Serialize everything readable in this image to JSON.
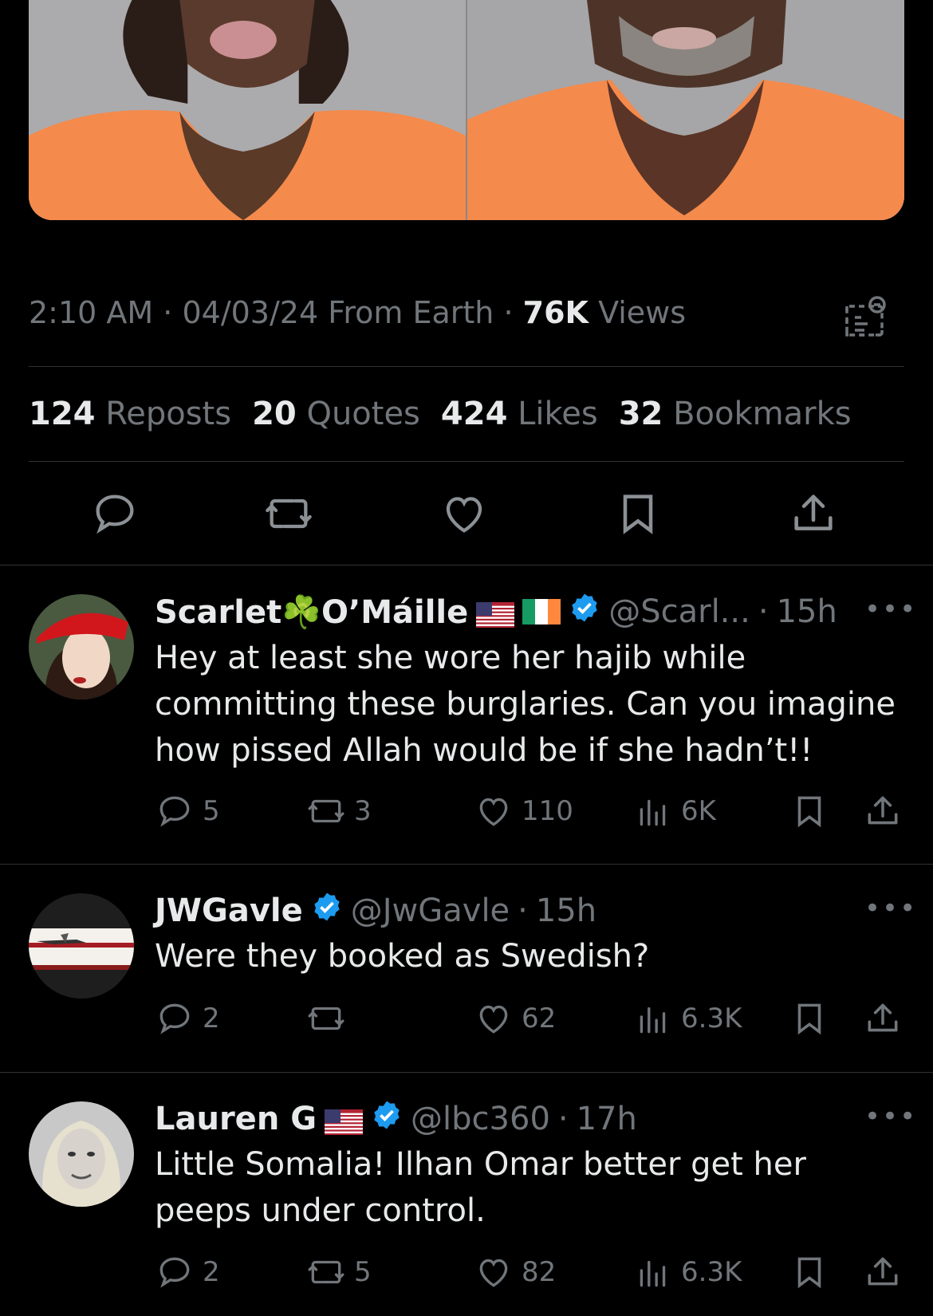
{
  "tweet": {
    "time": "2:10 AM",
    "date": "04/03/24",
    "source": "From Earth",
    "views_count": "76K",
    "views_label": "Views",
    "stats": [
      {
        "count": "124",
        "label": "Reposts"
      },
      {
        "count": "20",
        "label": "Quotes"
      },
      {
        "count": "424",
        "label": "Likes"
      },
      {
        "count": "32",
        "label": "Bookmarks"
      }
    ],
    "actions": [
      "reply-icon",
      "repost-icon",
      "like-icon",
      "bookmark-icon",
      "share-icon"
    ]
  },
  "replies": [
    {
      "name": "Scarlet☘️O’Máille",
      "handle": "@Scarl...",
      "time": "15h",
      "text": "Hey at least she wore her hajib while committing these burglaries. Can you imagine how pissed Allah would be if she hadn’t!!",
      "replies": "5",
      "reposts": "3",
      "likes": "110",
      "views": "6K"
    },
    {
      "name": "JWGavle",
      "handle": "@JwGavle",
      "time": "15h",
      "text": "Were they booked as Swedish?",
      "replies": "2",
      "reposts": "",
      "likes": "62",
      "views": "6.3K"
    },
    {
      "name": "Lauren G",
      "handle": "@lbc360",
      "time": "17h",
      "text": "Little Somalia!  Ilhan Omar better get her peeps under control.",
      "replies": "2",
      "reposts": "5",
      "likes": "82",
      "views": "6.3K"
    }
  ],
  "colors": {
    "background": "#000000",
    "text": "#e7e9ea",
    "muted": "#71767b",
    "divider": "#2f3336",
    "verified": "#1d9bf0",
    "jumpsuit": "#f4874b"
  }
}
